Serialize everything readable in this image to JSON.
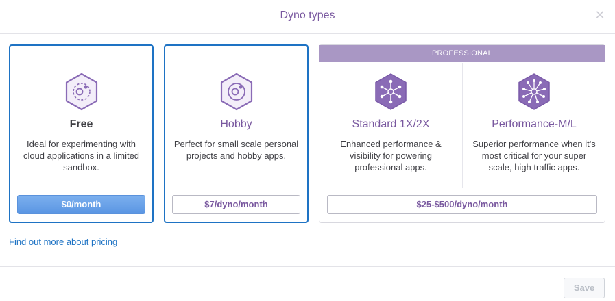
{
  "modal": {
    "title": "Dyno types"
  },
  "cards": {
    "free": {
      "name": "Free",
      "description": "Ideal for experimenting with cloud applications in a limited sandbox.",
      "price": "$0/month",
      "icon": "free-dyno-hex-icon"
    },
    "hobby": {
      "name": "Hobby",
      "description": "Perfect for small scale personal projects and hobby apps.",
      "price": "$7/dyno/month",
      "icon": "hobby-dyno-hex-icon"
    },
    "professional": {
      "band_label": "PROFESSIONAL",
      "price": "$25-$500/dyno/month",
      "standard": {
        "name": "Standard 1X/2X",
        "description": "Enhanced performance & visibility for powering professional apps.",
        "icon": "standard-dyno-network-icon"
      },
      "performance": {
        "name": "Performance-M/L",
        "description": "Superior performance when it's most critical for your super scale, high traffic apps.",
        "icon": "performance-dyno-network-icon"
      }
    }
  },
  "links": {
    "pricing": "Find out more about pricing"
  },
  "footer": {
    "save_label": "Save"
  },
  "colors": {
    "accent": "#79589f",
    "selected_border": "#1e73c4",
    "pro_band": "#a997c4",
    "free_button": "#5a96e3",
    "link": "#1e73c4"
  }
}
